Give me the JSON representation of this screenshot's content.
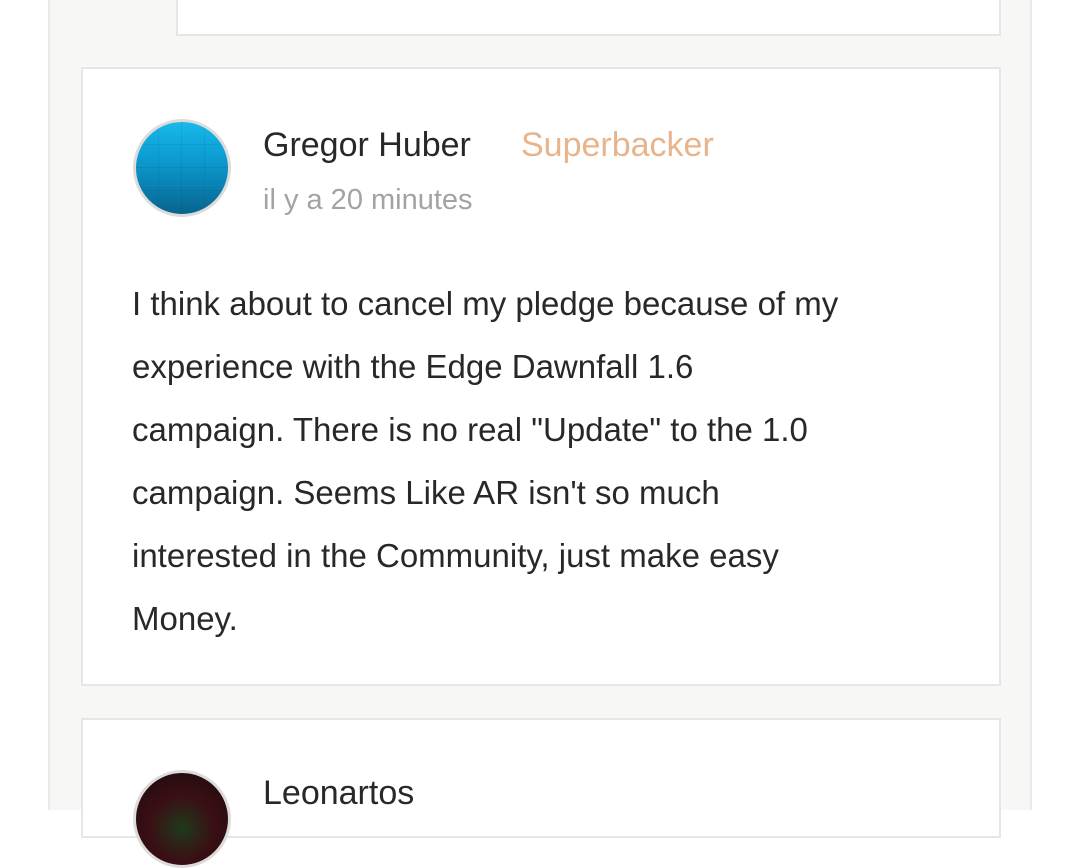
{
  "comments": [
    {
      "author": "Gregor Huber",
      "badge": "Superbacker",
      "time": "il y a 20 minutes",
      "lines": [
        "I think about to cancel my pledge because of my",
        "experience with the Edge Dawnfall 1.6",
        "campaign. There is no real \"Update\" to the 1.0",
        "campaign. Seems Like AR isn't so much",
        "interested in the Community, just make easy",
        "Money."
      ]
    },
    {
      "author": "Leonartos"
    }
  ],
  "colors": {
    "badge": "#e8b48c",
    "text": "#282828",
    "muted": "#a3a3a3",
    "panel_bg": "#f7f7f6",
    "border": "#e6e6e4"
  }
}
